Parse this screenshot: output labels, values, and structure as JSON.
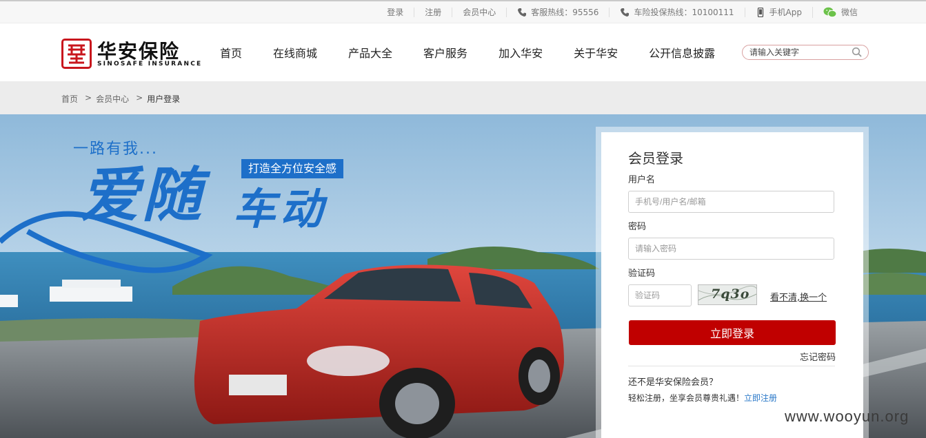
{
  "topbar": {
    "login": "登录",
    "register": "注册",
    "member_center": "会员中心",
    "service_hotline": "客服热线：95556",
    "car_complaint_hotline": "车险投保热线：10100111",
    "mobile_app": "手机App",
    "wechat": "微信"
  },
  "logo": {
    "name_cn": "华安保险",
    "name_en": "SINOSAFE INSURANCE"
  },
  "nav": {
    "items": [
      {
        "label": "首页"
      },
      {
        "label": "在线商城"
      },
      {
        "label": "产品大全"
      },
      {
        "label": "客户服务"
      },
      {
        "label": "加入华安"
      },
      {
        "label": "关于华安"
      },
      {
        "label": "公开信息披露"
      }
    ]
  },
  "search": {
    "placeholder": "请输入关键字"
  },
  "breadcrumb": {
    "home": "首页",
    "member_center": "会员中心",
    "current": "用户登录",
    "separator": ">"
  },
  "banner": {
    "line1": "一路有我...",
    "tag": "打造全方位安全感",
    "big1": "爱随",
    "big2": "车动"
  },
  "login": {
    "title": "会员登录",
    "username_label": "用户名",
    "username_placeholder": "手机号/用户名/邮箱",
    "password_label": "密码",
    "password_placeholder": "请输入密码",
    "captcha_label": "验证码",
    "captcha_placeholder": "验证码",
    "captcha_text": "7q3o",
    "refresh_captcha": "看不清,换一个",
    "submit": "立即登录",
    "forgot_password": "忘记密码",
    "not_member": "还不是华安保险会员？",
    "register_prompt": "轻松注册，坐享会员尊贵礼遇！",
    "register_link": "立即注册"
  },
  "watermark": "www.wooyun.org",
  "colors": {
    "brand_red": "#c00000",
    "brand_blue": "#1d6fc9",
    "link_blue": "#2a78c8"
  }
}
